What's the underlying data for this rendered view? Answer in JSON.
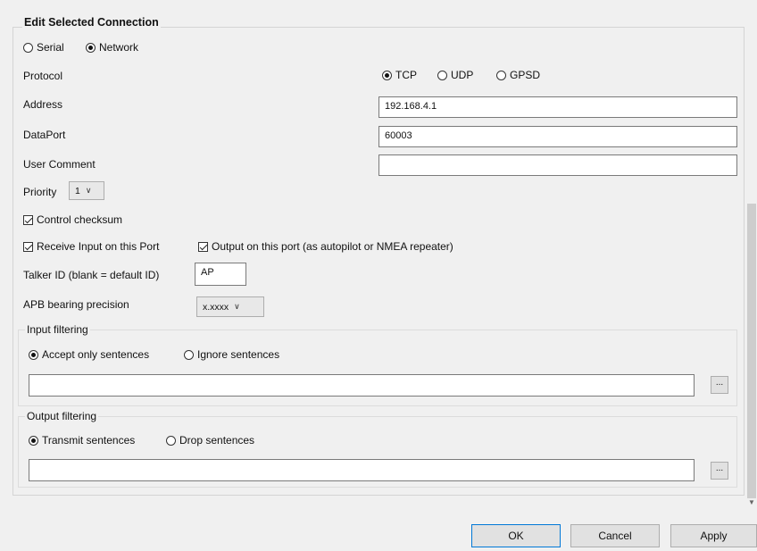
{
  "main_group": {
    "title": "Edit Selected Connection"
  },
  "connection_type": {
    "serial": "Serial",
    "network": "Network",
    "selected": "network"
  },
  "protocol": {
    "label": "Protocol",
    "tcp": "TCP",
    "udp": "UDP",
    "gpsd": "GPSD",
    "selected": "tcp"
  },
  "address": {
    "label": "Address",
    "value": "192.168.4.1"
  },
  "data_port": {
    "label": "DataPort",
    "value": "60003"
  },
  "user_comment": {
    "label": "User Comment",
    "value": ""
  },
  "priority": {
    "label": "Priority",
    "value": "1"
  },
  "control_checksum": {
    "label": "Control checksum",
    "checked": true
  },
  "receive_input": {
    "label": "Receive Input on this Port",
    "checked": true
  },
  "output_port": {
    "label": "Output on this port (as autopilot or NMEA repeater)",
    "checked": true
  },
  "talker_id": {
    "label": "Talker ID (blank = default ID)",
    "value": "AP"
  },
  "apb_precision": {
    "label": "APB bearing precision",
    "value": "x.xxxx"
  },
  "input_filtering": {
    "title": "Input filtering",
    "accept": "Accept only sentences",
    "ignore": "Ignore sentences",
    "selected": "accept",
    "value": "",
    "browse_label": "..."
  },
  "output_filtering": {
    "title": "Output filtering",
    "transmit": "Transmit sentences",
    "drop": "Drop sentences",
    "selected": "transmit",
    "value": "",
    "browse_label": "..."
  },
  "buttons": {
    "ok": "OK",
    "cancel": "Cancel",
    "apply": "Apply"
  }
}
